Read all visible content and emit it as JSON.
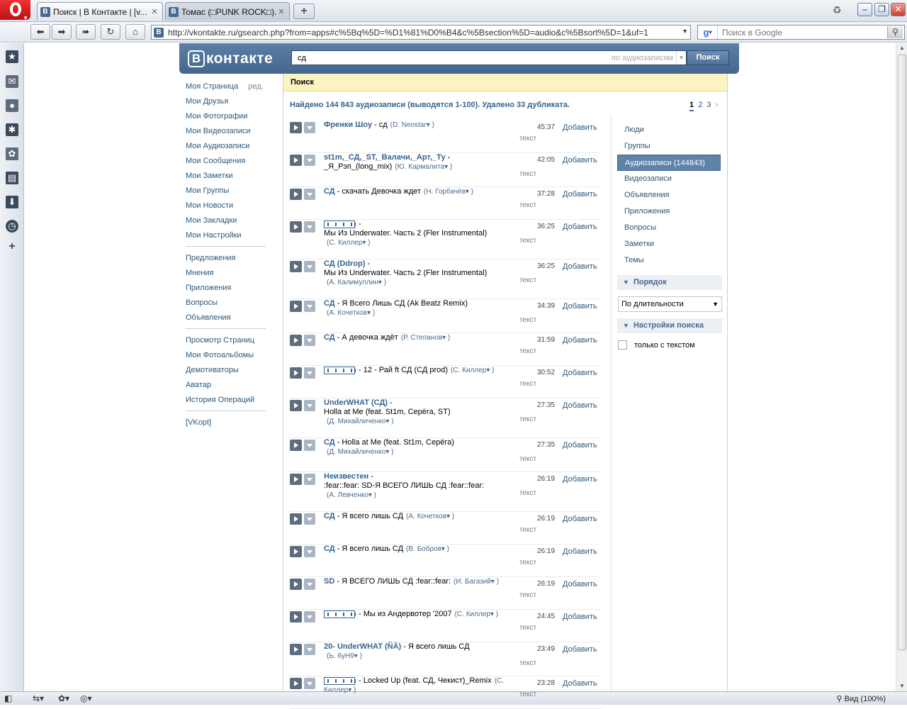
{
  "browser": {
    "tabs": [
      {
        "title": "Поиск | В Контакте | [v...",
        "favicon": "B",
        "active": true
      },
      {
        "title": "Томас (□PUNK ROCK□)...",
        "favicon": "B",
        "active": false
      }
    ],
    "url": "http://vkontakte.ru/gsearch.php?from=apps#c%5Bq%5D=%D1%81%D0%B4&c%5Bsection%5D=audio&c%5Bsort%5D=1&uf=1",
    "url_favicon": "B",
    "search_placeholder": "Поиск в Google",
    "zoom_label": "Вид (100%)"
  },
  "vk": {
    "logo_text": "контакте",
    "logo_letter": "В",
    "search_value": "сд",
    "search_scope": "по аудиозаписям",
    "search_button": "Поиск"
  },
  "menu": {
    "edit_label": "ред.",
    "groups": [
      [
        "Моя Страница",
        "Мои Друзья",
        "Мои Фотографии",
        "Мои Видеозаписи",
        "Мои Аудиозаписи",
        "Мои Сообщения",
        "Мои Заметки",
        "Мои Группы",
        "Мои Новости",
        "Мои Закладки",
        "Мои Настройки"
      ],
      [
        "Предложения",
        "Мнения",
        "Приложения",
        "Вопросы",
        "Объявления"
      ],
      [
        "Просмотр Страниц",
        "Мои Фотоальбомы",
        "Демотиваторы",
        "Аватар",
        "История Операций"
      ],
      [
        "[VKopt]"
      ]
    ]
  },
  "content": {
    "header": "Поиск",
    "summary": "Найдено 144 843 аудиозаписи (выводятся 1-100). Удалено 33 дубликата.",
    "pager": [
      "1",
      "2",
      "3",
      "›"
    ]
  },
  "right": {
    "links": [
      "Люди",
      "Группы",
      "Аудиозаписи (144843)",
      "Видеозаписи",
      "Объявления",
      "Приложения",
      "Вопросы",
      "Заметки",
      "Темы"
    ],
    "active_index": 2,
    "order_title": "Порядок",
    "sort_value": "По длительности",
    "settings_title": "Настройки поиска",
    "only_text_label": "только с текстом"
  },
  "audio_labels": {
    "lyrics": "текст",
    "add": "Добавить"
  },
  "audio": [
    {
      "artist": "Френки Шоу",
      "sep": " - ",
      "title": "сд",
      "user": "(D. Neostar▾ )",
      "dur": "45:37",
      "lines": 1
    },
    {
      "artist": "st1m,_СД,_ST,_Валачи,_Арт,_Ту",
      "sep": " -",
      "title": "_Я_Рэп_(long_mix)",
      "user": "(Ю. Кармалита▾ )",
      "dur": "42:05",
      "lines": 2,
      "inline_user": true
    },
    {
      "artist": "СД",
      "sep": " - ",
      "title": "скачать Девочка ждет",
      "user": "(Н. Горбачёв▾ )",
      "dur": "37:28",
      "lines": 1
    },
    {
      "artist": "",
      "glyph": true,
      "sep": " -",
      "title": "Мы Из Underwater. Часть 2 (Fler Instrumental)",
      "user": "(С. Киллер▾ )",
      "dur": "36:25",
      "lines": 3
    },
    {
      "artist": "СД (Ddrop)",
      "sep": " -",
      "title": "Мы Из Underwater. Часть 2 (Fler Instrumental)",
      "user": "(А. Калимуллин▾ )",
      "dur": "36:25",
      "lines": 3
    },
    {
      "artist": "СД",
      "sep": " - ",
      "title": "Я Всего Лишь СД (Ak Beatz Remix)",
      "user": "(А. Кочетков▾ )",
      "dur": "34:39",
      "lines": 2
    },
    {
      "artist": "СД",
      "sep": " - ",
      "title": "А девочка ждёт",
      "user": "(Р. Степанов▾ )",
      "dur": "31:59",
      "lines": 1
    },
    {
      "artist": "",
      "glyph": true,
      "sep": " - ",
      "title": "12 - Рай ft СД (СД prod)",
      "user": "(С. Киллер▾ )",
      "dur": "30:52",
      "lines": 1
    },
    {
      "artist": "UnderWHAT (СД)",
      "sep": " -",
      "title": "Holla at Me (feat. St1m, Серёга, ST)",
      "user": "(Д. Михайличенко▾ )",
      "dur": "27:35",
      "lines": 3
    },
    {
      "artist": "СД",
      "sep": " - ",
      "title": "Holla at Me (feat. St1m, Серёга)",
      "user": "(Д. Михайличенко▾ )",
      "dur": "27:35",
      "lines": 2
    },
    {
      "artist": "Неизвестен",
      "sep": " -",
      "title": ":fear::fear: SD-Я ВСЕГО ЛИШЬ СД :fear::fear:",
      "user": "(А. Левченко▾ )",
      "dur": "26:19",
      "lines": 3
    },
    {
      "artist": "СД",
      "sep": " - ",
      "title": "Я всего лишь СД",
      "user": "(А. Кочетков▾ )",
      "dur": "26:19",
      "lines": 1
    },
    {
      "artist": "СД",
      "sep": " - ",
      "title": "Я всего лишь СД",
      "user": "(В. Бобров▾ )",
      "dur": "26:19",
      "lines": 1
    },
    {
      "artist": "SD",
      "sep": " - ",
      "title": "Я ВСЕГО ЛИШЬ СД :fear::fear:",
      "user": "(И. Багазий▾ )",
      "dur": "26:19",
      "lines": 1
    },
    {
      "artist": "",
      "glyph": true,
      "sep": " - ",
      "title": "Мы из Андервотер '2007",
      "user": "(С. Киллер▾ )",
      "dur": "24:45",
      "lines": 1
    },
    {
      "artist": "20- UnderWHAT (ÑÄ)",
      "sep": " - ",
      "title": "Я всего лишь СД",
      "user": "(Ь. 6уН9▾ )",
      "dur": "23:49",
      "lines": 2
    },
    {
      "artist": "",
      "glyph": true,
      "sep": " - ",
      "title": "Locked Up (feat. СД, Чекист)_Remix",
      "user": "(С. Киллер▾ )",
      "dur": "23:28",
      "lines": 1
    }
  ]
}
